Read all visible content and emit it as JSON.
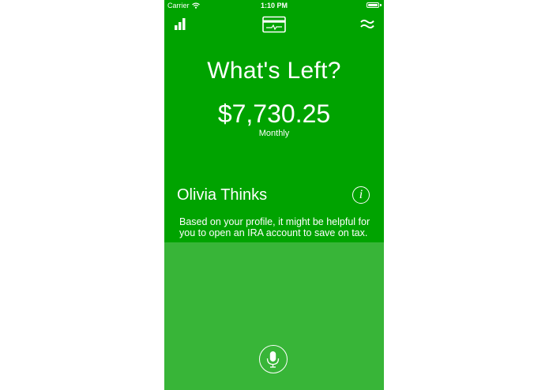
{
  "status_bar": {
    "carrier": "Carrier",
    "time": "1:10 PM",
    "battery_level": 1.0
  },
  "nav": {
    "left_icon": "bar-chart-icon",
    "center_icon": "credit-card-icon",
    "right_icon": "wave-menu-icon"
  },
  "main": {
    "headline": "What's Left?",
    "amount": "$7,730.25",
    "period": "Monthly"
  },
  "advice": {
    "title": "Olivia Thinks",
    "info_icon_glyph": "i",
    "text": "Based on your profile, it might be helpful for you to open an IRA account to save on tax."
  },
  "footer": {
    "mic_icon": "microphone-icon"
  },
  "colors": {
    "top_background": "#00a300",
    "bottom_background": "#38b538",
    "foreground": "#ffffff"
  }
}
